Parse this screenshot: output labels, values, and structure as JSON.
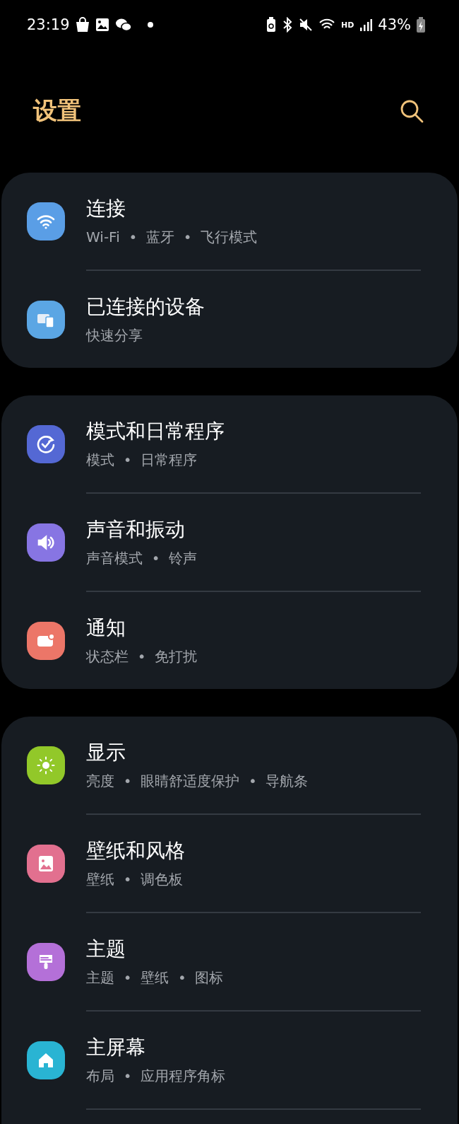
{
  "status_bar": {
    "time": "23:19",
    "network_label": "HD",
    "battery": "43%"
  },
  "header": {
    "title": "设置"
  },
  "groups": [
    {
      "items": [
        {
          "kind": "wifi",
          "color": "#5a9ee6",
          "title": "连接",
          "subtitle": "Wi-Fi  •  蓝牙  •  飞行模式"
        },
        {
          "kind": "devices",
          "color": "#5ba6e4",
          "title": "已连接的设备",
          "subtitle": "快速分享"
        }
      ]
    },
    {
      "items": [
        {
          "kind": "check",
          "color": "#5468d4",
          "title": "模式和日常程序",
          "subtitle": "模式  •  日常程序"
        },
        {
          "kind": "sound",
          "color": "#8775e3",
          "title": "声音和振动",
          "subtitle": "声音模式  •  铃声"
        },
        {
          "kind": "notification",
          "color": "#ec7668",
          "title": "通知",
          "subtitle": "状态栏  •  免打扰"
        }
      ]
    },
    {
      "items": [
        {
          "kind": "sun",
          "color": "#92c829",
          "title": "显示",
          "subtitle": "亮度  •  眼睛舒适度保护  •  导航条"
        },
        {
          "kind": "image",
          "color": "#e2708f",
          "title": "壁纸和风格",
          "subtitle": "壁纸  •  调色板"
        },
        {
          "kind": "brush",
          "color": "#b470d8",
          "title": "主题",
          "subtitle": "主题  •  壁纸  •  图标"
        },
        {
          "kind": "home",
          "color": "#29b4d3",
          "title": "主屏幕",
          "subtitle": "布局  •  应用程序角标"
        }
      ]
    }
  ]
}
